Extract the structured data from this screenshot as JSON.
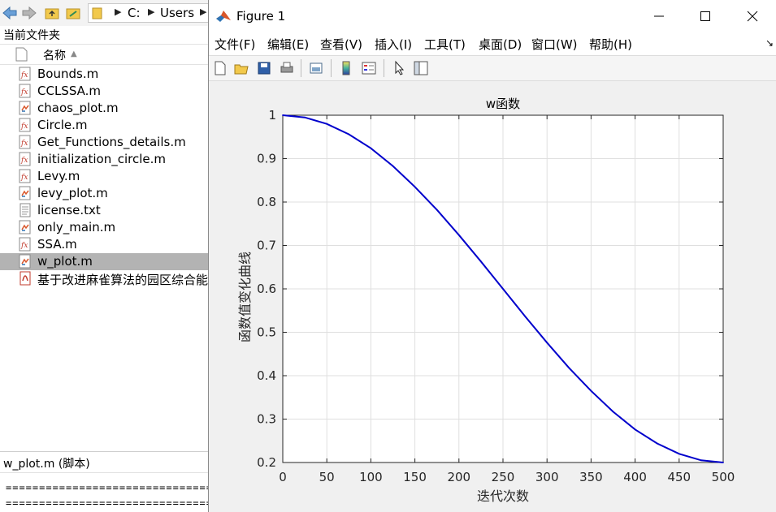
{
  "left_panel": {
    "path": [
      "C:",
      "Users"
    ],
    "folder_title": "当前文件夹",
    "column_name": "名称",
    "files": [
      {
        "name": "Bounds.m",
        "icon": "function-file-icon"
      },
      {
        "name": "CCLSSA.m",
        "icon": "function-file-icon"
      },
      {
        "name": "chaos_plot.m",
        "icon": "script-file-icon"
      },
      {
        "name": "Circle.m",
        "icon": "function-file-icon"
      },
      {
        "name": "Get_Functions_details.m",
        "icon": "function-file-icon"
      },
      {
        "name": "initialization_circle.m",
        "icon": "function-file-icon"
      },
      {
        "name": "Levy.m",
        "icon": "function-file-icon"
      },
      {
        "name": "levy_plot.m",
        "icon": "script-file-icon"
      },
      {
        "name": "license.txt",
        "icon": "text-file-icon"
      },
      {
        "name": "only_main.m",
        "icon": "script-file-icon"
      },
      {
        "name": "SSA.m",
        "icon": "function-file-icon"
      },
      {
        "name": "w_plot.m",
        "icon": "script-file-icon",
        "selected": true
      },
      {
        "name": "基于改进麻雀算法的园区综合能",
        "icon": "pdf-file-icon"
      }
    ],
    "detail_title": "w_plot.m  (脚本)",
    "detail_lines": [
      "=========================================",
      "========================================="
    ]
  },
  "figure_window": {
    "title": "Figure 1",
    "menus": [
      "文件(F)",
      "编辑(E)",
      "查看(V)",
      "插入(I)",
      "工具(T)",
      "桌面(D)",
      "窗口(W)",
      "帮助(H)"
    ],
    "toolbar_icons": [
      "new-figure-icon",
      "open-icon",
      "save-icon",
      "print-icon",
      "link-plot-icon",
      "colorbar-icon",
      "legend-icon",
      "pointer-icon",
      "property-editor-icon"
    ]
  },
  "chart_data": {
    "type": "line",
    "title": "w函数",
    "xlabel": "迭代次数",
    "ylabel": "函数值变化曲线",
    "xlim": [
      0,
      500
    ],
    "ylim": [
      0.2,
      1.0
    ],
    "xticks": [
      0,
      50,
      100,
      150,
      200,
      250,
      300,
      350,
      400,
      450,
      500
    ],
    "xtick_labels": [
      "0",
      "50",
      "100",
      "150",
      "200",
      "250",
      "300",
      "350",
      "400",
      "450",
      "500"
    ],
    "yticks": [
      0.2,
      0.3,
      0.4,
      0.5,
      0.6,
      0.7,
      0.8,
      0.9,
      1.0
    ],
    "ytick_labels": [
      "0.2",
      "0.3",
      "0.4",
      "0.5",
      "0.6",
      "0.7",
      "0.8",
      "0.9",
      "1"
    ],
    "grid": true,
    "line_color": "#0000cc",
    "series": [
      {
        "x": [
          0,
          25,
          50,
          75,
          100,
          125,
          150,
          175,
          200,
          225,
          250,
          275,
          300,
          325,
          350,
          375,
          400,
          425,
          450,
          475,
          500
        ],
        "y": [
          1.0,
          0.995,
          0.98,
          0.956,
          0.924,
          0.883,
          0.835,
          0.782,
          0.724,
          0.663,
          0.6,
          0.537,
          0.476,
          0.418,
          0.365,
          0.317,
          0.276,
          0.244,
          0.22,
          0.205,
          0.2
        ]
      }
    ]
  }
}
